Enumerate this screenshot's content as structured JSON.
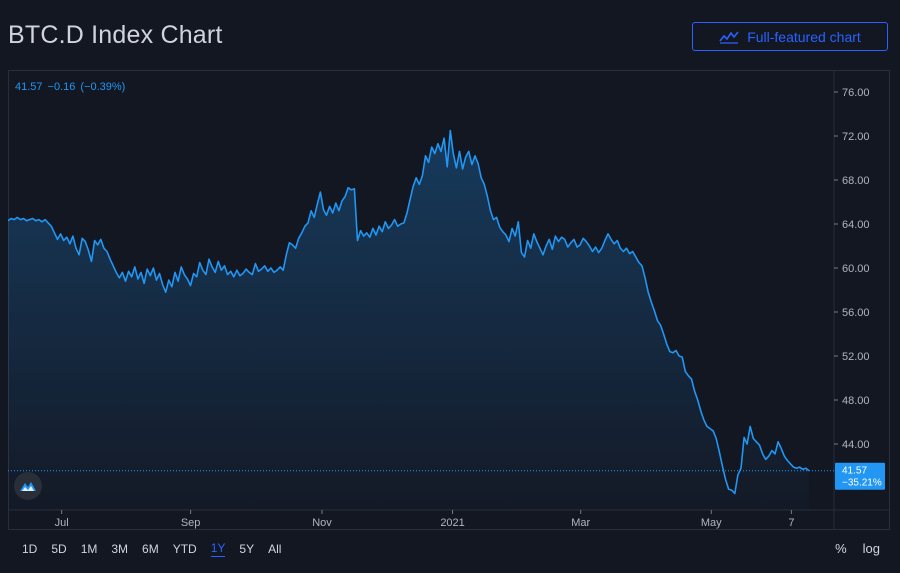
{
  "header": {
    "title": "BTC.D Index Chart",
    "full_chart_label": "Full-featured chart",
    "full_chart_icon": "chart-line-icon"
  },
  "legend": {
    "last": "41.57",
    "change": "−0.16",
    "change_pct": "(−0.39%)"
  },
  "price_label": {
    "value": "41.57",
    "pct": "−35.21%"
  },
  "colors": {
    "line": "#2196f3",
    "accent": "#2962ff",
    "background": "#131722"
  },
  "range_buttons": [
    "1D",
    "5D",
    "1M",
    "3M",
    "6M",
    "YTD",
    "1Y",
    "5Y",
    "All"
  ],
  "active_range": "1Y",
  "tools": {
    "percent": "%",
    "log": "log"
  },
  "chart_data": {
    "type": "area",
    "ylim": [
      38.0,
      78.0
    ],
    "y_ticks": [
      "76.00",
      "72.00",
      "68.00",
      "64.00",
      "60.00",
      "56.00",
      "52.00",
      "48.00",
      "44.00"
    ],
    "x_ticks": [
      {
        "label": "Jul",
        "pos": 0.067
      },
      {
        "label": "Sep",
        "pos": 0.228
      },
      {
        "label": "Nov",
        "pos": 0.392
      },
      {
        "label": "2021",
        "pos": 0.555
      },
      {
        "label": "Mar",
        "pos": 0.715
      },
      {
        "label": "May",
        "pos": 0.878
      },
      {
        "label": "7",
        "pos": 0.978
      }
    ],
    "series": [
      {
        "values": [
          64.3,
          64.5,
          64.4,
          64.6,
          64.4,
          64.5,
          64.3,
          64.4,
          64.5,
          64.3,
          64.4,
          64.2,
          64.4,
          64.1,
          63.8,
          63.2,
          62.6,
          63.1,
          62.5,
          62.8,
          62.2,
          62.9,
          61.8,
          61.2,
          62.7,
          62.4,
          61.6,
          60.6,
          62.5,
          62.1,
          62.6,
          61.8,
          61.5,
          60.8,
          60.2,
          59.6,
          59.1,
          59.6,
          58.8,
          59.7,
          59.2,
          60.1,
          59.0,
          59.6,
          58.6,
          59.9,
          59.3,
          60.0,
          58.9,
          59.5,
          58.5,
          57.8,
          58.9,
          58.3,
          59.6,
          58.8,
          60.1,
          59.4,
          59.0,
          58.4,
          59.5,
          59.2,
          60.5,
          59.8,
          59.4,
          60.8,
          60.1,
          59.6,
          60.6,
          59.8,
          60.2,
          59.4,
          59.7,
          59.2,
          59.8,
          59.3,
          59.5,
          59.9,
          59.6,
          59.4,
          60.4,
          59.7,
          59.9,
          60.2,
          59.7,
          60.0,
          59.6,
          59.8,
          60.1,
          59.8,
          61.2,
          62.3,
          62.1,
          61.8,
          62.7,
          63.2,
          63.8,
          64.1,
          65.2,
          64.6,
          65.8,
          66.9,
          65.3,
          64.8,
          65.6,
          65.0,
          65.9,
          65.2,
          66.1,
          66.5,
          67.3,
          67.1,
          67.2,
          62.5,
          63.4,
          62.9,
          63.2,
          62.8,
          63.6,
          63.0,
          63.8,
          63.3,
          64.2,
          63.6,
          63.9,
          64.4,
          63.8,
          64.0,
          64.1,
          65.0,
          66.2,
          67.4,
          68.2,
          67.6,
          68.4,
          70.2,
          69.6,
          71.0,
          70.4,
          71.3,
          70.6,
          71.8,
          69.2,
          72.5,
          70.4,
          69.1,
          70.6,
          69.0,
          70.1,
          70.6,
          69.4,
          70.2,
          69.5,
          68.2,
          67.6,
          66.5,
          65.2,
          64.4,
          64.6,
          63.7,
          63.3,
          63.0,
          62.4,
          63.6,
          62.9,
          64.2,
          61.4,
          61.0,
          62.5,
          61.8,
          63.1,
          62.4,
          61.8,
          61.2,
          62.0,
          62.6,
          61.7,
          62.9,
          62.4,
          62.8,
          62.6,
          61.9,
          62.3,
          62.6,
          61.9,
          62.1,
          62.7,
          62.4,
          62.0,
          61.5,
          61.9,
          61.4,
          61.8,
          62.5,
          63.1,
          62.6,
          62.2,
          62.5,
          61.8,
          61.5,
          61.8,
          61.3,
          61.5,
          61.0,
          60.5,
          60.2,
          59.1,
          57.8,
          56.9,
          56.1,
          55.2,
          54.8,
          54.0,
          53.1,
          52.4,
          52.3,
          52.5,
          52.0,
          51.9,
          50.6,
          50.2,
          49.9,
          48.8,
          48.0,
          47.0,
          46.2,
          45.6,
          45.4,
          45.2,
          44.5,
          43.3,
          42.0,
          40.8,
          39.9,
          39.8,
          39.5,
          41.2,
          41.8,
          44.6,
          44.0,
          45.6,
          44.5,
          44.2,
          43.9,
          43.1,
          42.6,
          42.9,
          43.4,
          43.1,
          44.2,
          43.6,
          42.9,
          42.5,
          42.2,
          41.9,
          41.8,
          41.9,
          41.7,
          41.8,
          41.57
        ]
      }
    ]
  }
}
